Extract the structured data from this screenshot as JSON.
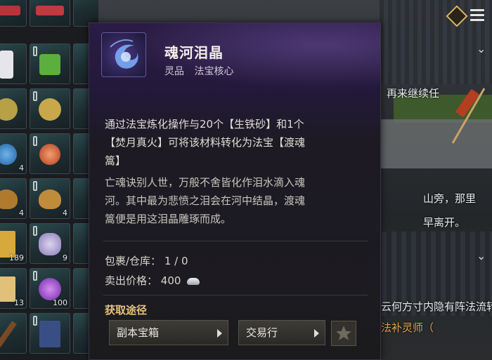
{
  "tooltip": {
    "item_name": "魂河泪晶",
    "grade": "灵品",
    "category": "法宝核心",
    "desc_line1": "通过法宝炼化操作与20个【生铁砂】和1个",
    "desc_line2": "【焚月真火】可将该材料转化为法宝【渡魂",
    "desc_line3": "篙】",
    "lore_line1": "亡魂诀别人世，万般不舍皆化作泪水滴入魂",
    "lore_line2": "河。其中最为悲愤之泪会在河中结晶，渡魂",
    "lore_line3": "篙便是用这泪晶雕琢而成。",
    "storage_label": "包裹/仓库：",
    "storage_value": "1 / 0",
    "price_label": "卖出价格：",
    "price_value": "400",
    "acquire_title": "获取途径",
    "sources": [
      {
        "label": "副本宝箱"
      },
      {
        "label": "交易行"
      }
    ]
  },
  "scene": {
    "text_top_right": "再来继续任",
    "text_mid_right_1": "山旁，那里",
    "text_mid_right_2": "早离开。",
    "text_bottom_1": "云何方寸内隐有阵法流转，根据帮派",
    "text_bottom_2": "法补灵师（"
  },
  "inventory": {
    "counts": [
      "4",
      "4",
      "4",
      "189",
      "9",
      "13",
      "100"
    ]
  },
  "colors": {
    "accent_gold": "#e6c27a",
    "highlight_orange": "#e8a14a"
  }
}
